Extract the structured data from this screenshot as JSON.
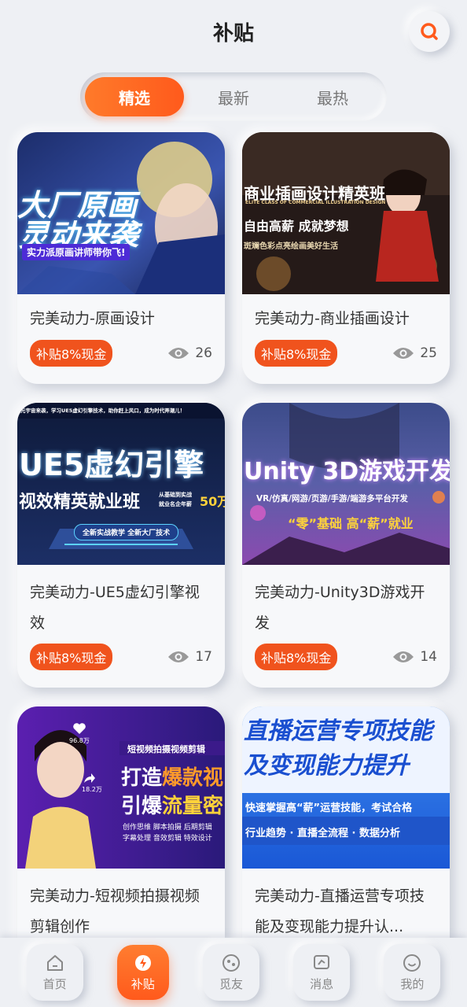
{
  "header": {
    "title": "补贴"
  },
  "tabs": [
    {
      "label": "精选",
      "active": true
    },
    {
      "label": "最新",
      "active": false
    },
    {
      "label": "最热",
      "active": false
    }
  ],
  "cards": [
    {
      "title": "完美动力-原画设计",
      "badge": "补贴8%现金",
      "views": "26",
      "banner": {
        "line1": "大厂原画",
        "line2": "灵动来袭",
        "tag": "实力派原画讲师带你飞!"
      }
    },
    {
      "title": "完美动力-商业插画设计",
      "badge": "补贴8%现金",
      "views": "25",
      "banner": {
        "line1": "商业插画设计精英班",
        "line2": "ELITE CLASS OF COMMERCIAL ILLUSTRATION DESIGN",
        "line3": "自由高薪 成就梦想",
        "line4": "斑斓色彩点亮绘画美好生活"
      }
    },
    {
      "title": "完美动力-UE5虚幻引擎视效",
      "badge": "补贴8%现金",
      "views": "17",
      "banner": {
        "top": "元宇宙来袭，学习UE5虚幻引擎技术，助你赶上风口，成为时代弄潮儿！",
        "line1": "UE5虚幻引擎",
        "line2": "视效精英就业班",
        "side1": "从基础到实战",
        "side2": "就业名企年薪",
        "salary": "50万",
        "pill": "全新实战教学 全新大厂技术"
      }
    },
    {
      "title": "完美动力-Unity3D游戏开发",
      "badge": "补贴8%现金",
      "views": "14",
      "banner": {
        "line1": "Unity 3D游戏开发",
        "line2": "VR/仿真/网游/页游/手游/端游多平台开发",
        "line3": "“零”基础 高“薪”就业"
      }
    },
    {
      "title": "完美动力-短视频拍摄视频剪辑创作",
      "badge": "",
      "views": "",
      "banner": {
        "likes": "96.8万",
        "shares": "18.2万",
        "top": "短视频拍摄视频剪辑",
        "line1a": "打造",
        "line1b": "爆款视",
        "line2a": "引爆",
        "line2b": "流量密",
        "tags1": "创作思维 脚本拍摄 后期剪辑",
        "tags2": "字幕处理 音效剪辑 特效设计"
      }
    },
    {
      "title": "完美动力-直播运营专项技能及变现能力提升认...",
      "badge": "",
      "views": "",
      "banner": {
        "line1": "直播运营专项技能",
        "line2": "及变现能力提升",
        "line3": "快速掌握高“薪”运营技能，考试合格",
        "line4": "行业趋势 · 直播全流程 · 数据分析"
      }
    }
  ],
  "nav": [
    {
      "label": "首页",
      "icon": "home-icon",
      "active": false
    },
    {
      "label": "补贴",
      "icon": "lightning-icon",
      "active": true
    },
    {
      "label": "觅友",
      "icon": "planet-icon",
      "active": false
    },
    {
      "label": "消息",
      "icon": "message-icon",
      "active": false
    },
    {
      "label": "我的",
      "icon": "smile-icon",
      "active": false
    }
  ],
  "colors": {
    "accent": "#ff6a22",
    "badge": "#f0531d",
    "background": "#eef0f4"
  }
}
